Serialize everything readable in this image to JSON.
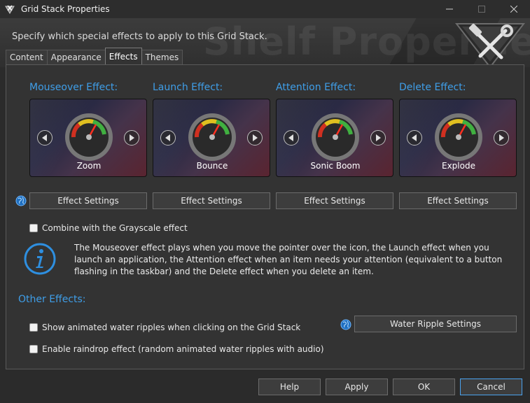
{
  "window": {
    "title": "Grid Stack Properties",
    "controls": [
      "minimize",
      "maximize",
      "close"
    ]
  },
  "banner": {
    "description": "Specify which special effects to apply to this Grid Stack.",
    "watermark": "Shelf Properties"
  },
  "tabs": [
    {
      "label": "Content",
      "active": false
    },
    {
      "label": "Appearance",
      "active": false
    },
    {
      "label": "Effects",
      "active": true
    },
    {
      "label": "Themes",
      "active": false
    }
  ],
  "effects": [
    {
      "label": "Mouseover Effect:",
      "value": "Zoom",
      "button": "Effect Settings"
    },
    {
      "label": "Launch Effect:",
      "value": "Bounce",
      "button": "Effect Settings"
    },
    {
      "label": "Attention Effect:",
      "value": "Sonic Boom",
      "button": "Effect Settings"
    },
    {
      "label": "Delete Effect:",
      "value": "Explode",
      "button": "Effect Settings"
    }
  ],
  "grayscale": {
    "label": "Combine with the Grayscale effect",
    "checked": false
  },
  "info": {
    "text": "The Mouseover effect plays when you move the pointer over the icon, the Launch effect when you launch an application, the Attention effect when an item needs your attention (equivalent to a button flashing in the taskbar) and the Delete effect when you delete an item."
  },
  "other_effects": {
    "heading": "Other Effects:",
    "water_ripples": {
      "label": "Show animated water ripples when clicking on the Grid Stack",
      "checked": false
    },
    "raindrop": {
      "label": "Enable raindrop effect (random animated water ripples with audio)",
      "checked": false
    },
    "ripple_settings_button": "Water Ripple Settings"
  },
  "footer": {
    "help": "Help",
    "apply": "Apply",
    "ok": "OK",
    "cancel": "Cancel"
  },
  "colors": {
    "accent": "#3f9ee8",
    "background": "#333333",
    "titlebar": "#2d2d2d"
  }
}
